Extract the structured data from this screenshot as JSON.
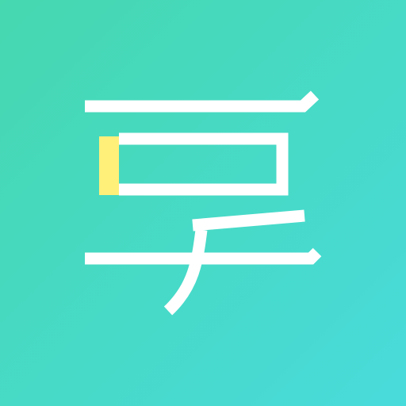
{
  "icon": {
    "name": "share-app-icon",
    "glyph": "享",
    "colors": {
      "gradient_start": "#46D8AF",
      "gradient_end": "#48DBDB",
      "stroke": "#FFFFFF",
      "accent": "#FFF07A"
    }
  }
}
